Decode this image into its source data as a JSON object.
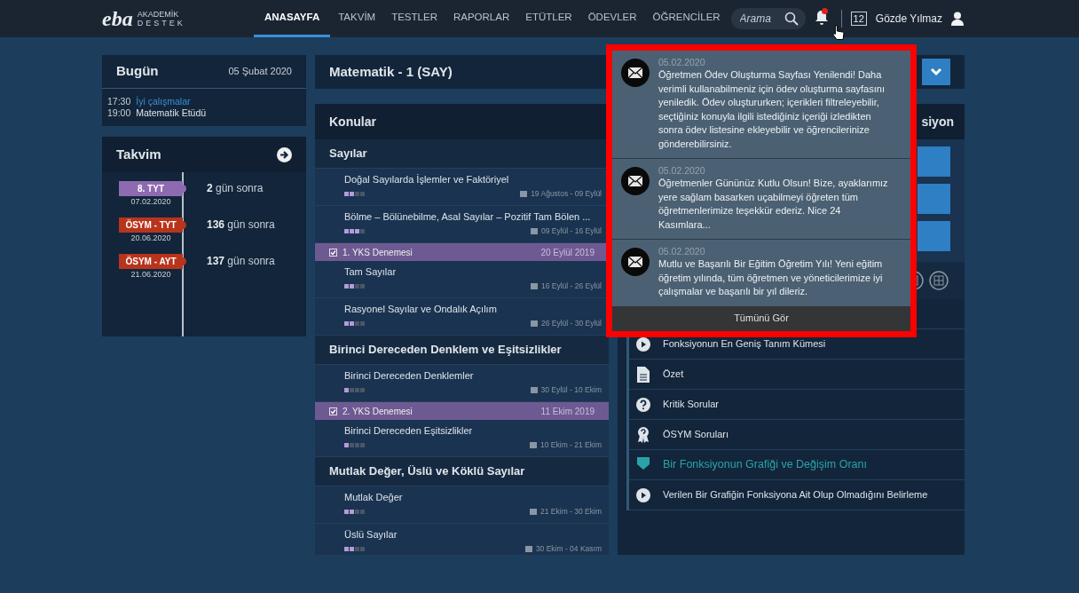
{
  "header": {
    "logo": "eba",
    "logo_sub": [
      "AKADEMİK",
      "DESTEK"
    ],
    "nav": [
      {
        "label": "ANASAYFA",
        "selected": true
      },
      {
        "label": "TAKVİM",
        "selected": false
      },
      {
        "label": "TESTLER",
        "selected": false
      },
      {
        "label": "RAPORLAR",
        "selected": false
      },
      {
        "label": "ETÜTLER",
        "selected": false
      },
      {
        "label": "ÖDEVLER",
        "selected": false
      },
      {
        "label": "ÖĞRENCİLER",
        "selected": false
      }
    ],
    "search": {
      "placeholder": "Arama"
    },
    "notifications": {
      "unread": true
    },
    "calendar_day": "12",
    "user": "Gözde Yılmaz"
  },
  "today": {
    "title": "Bugün",
    "date": "05 Şubat 2020",
    "events": [
      {
        "time": "17:30",
        "text": "İyi çalışmalar",
        "kind": "link"
      },
      {
        "time": "19:00",
        "text": "Matematik Etüdü",
        "kind": "plain"
      }
    ]
  },
  "calendar": {
    "title": "Takvim",
    "items": [
      {
        "label": "8. TYT",
        "date": "07.02.2020",
        "days": "2",
        "suffix": "gün sonra",
        "color": "#8e6bb0"
      },
      {
        "label": "ÖSYM - TYT",
        "date": "20.06.2020",
        "days": "136",
        "suffix": "gün sonra",
        "color": "#b8341c"
      },
      {
        "label": "ÖSYM - AYT",
        "date": "21.06.2020",
        "days": "137",
        "suffix": "gün sonra",
        "color": "#b8341c"
      }
    ]
  },
  "course": {
    "title": "Matematik - 1 (SAY)"
  },
  "topics": {
    "title": "Konular",
    "rows": [
      {
        "kind": "section",
        "title": "Sayılar"
      },
      {
        "kind": "topic",
        "title": "Doğal Sayılarda İşlemler ve Faktöriyel",
        "level": 0.5,
        "dates": "19 Ağustos - 09 Eylül"
      },
      {
        "kind": "topic",
        "title": "Bölme – Bölünebilme, Asal Sayılar – Pozitif Tam Bölen ...",
        "level": 0.75,
        "dates": "09 Eylül - 16 Eylül"
      },
      {
        "kind": "exam",
        "title": "1. YKS Denemesi",
        "checked": true,
        "date": "20 Eylül 2019"
      },
      {
        "kind": "topic",
        "title": "Tam Sayılar",
        "level": 0.5,
        "dates": "16 Eylül - 26 Eylül"
      },
      {
        "kind": "topic",
        "title": "Rasyonel Sayılar ve Ondalık Açılım",
        "level": 0.5,
        "dates": "26 Eylül - 30 Eylül"
      },
      {
        "kind": "section",
        "title": "Birinci Dereceden Denklem ve Eşitsizlikler"
      },
      {
        "kind": "topic",
        "title": "Birinci Dereceden Denklemler",
        "level": 0.25,
        "dates": "30 Eylül - 10 Ekim"
      },
      {
        "kind": "exam",
        "title": "2. YKS Denemesi",
        "checked": true,
        "date": "11 Ekim 2019"
      },
      {
        "kind": "topic",
        "title": "Birinci Dereceden Eşitsizlikler",
        "level": 0.25,
        "dates": "10 Ekim - 21 Ekim"
      },
      {
        "kind": "section",
        "title": "Mutlak Değer, Üslü ve Köklü Sayılar"
      },
      {
        "kind": "topic",
        "title": "Mutlak Değer",
        "level": 0.5,
        "dates": "21 Ekim - 30 Ekim"
      },
      {
        "kind": "topic",
        "title": "Üslü Sayılar",
        "level": 0.5,
        "dates": "30 Ekim - 04 Kasım"
      }
    ]
  },
  "lessons": {
    "title": "siyon",
    "rows": [
      {
        "kind": "video",
        "title": "Fonksiyonun En Geniş Tanım Kümesi"
      },
      {
        "kind": "document",
        "title": "Özet"
      },
      {
        "kind": "question",
        "title": "Kritik Sorular"
      },
      {
        "kind": "award",
        "title": "ÖSYM Soruları"
      },
      {
        "kind": "section",
        "title": "Bir Fonksiyonun Grafiği ve Değişim Oranı"
      },
      {
        "kind": "video",
        "title": "Verilen Bir Grafiğin Fonksiyona Ait Olup Olmadığını Belirleme"
      }
    ]
  },
  "notification_popup": {
    "items": [
      {
        "date": "05.02.2020",
        "text": "Öğretmen Ödev Oluşturma Sayfası Yenilendi! Daha verimli kullanabilmeniz için ödev oluşturma sayfasını yeniledik. Ödev oluştururken; içerikleri filtreleyebilir, seçtiğiniz konuyla ilgili istediğiniz içeriği izledikten sonra ödev listesine ekleyebilir ve öğrencilerinize gönderebilirsiniz."
      },
      {
        "date": "05.02.2020",
        "text": "Öğretmenler Gününüz Kutlu Olsun! Bize, ayaklarımız yere sağlam basarken uçabilmeyi öğreten tüm öğretmenlerimize teşekkür ederiz. Nice 24 Kasımlara..."
      },
      {
        "date": "05.02.2020",
        "text": "Mutlu ve Başarılı Bir Eğitim Öğretim Yılı! Yeni eğitim öğretim yılında, tüm öğretmen ve yöneticilerimize iyi çalışmalar ve başarılı bir yıl dileriz."
      }
    ],
    "footer": "Tümünü Gör"
  }
}
